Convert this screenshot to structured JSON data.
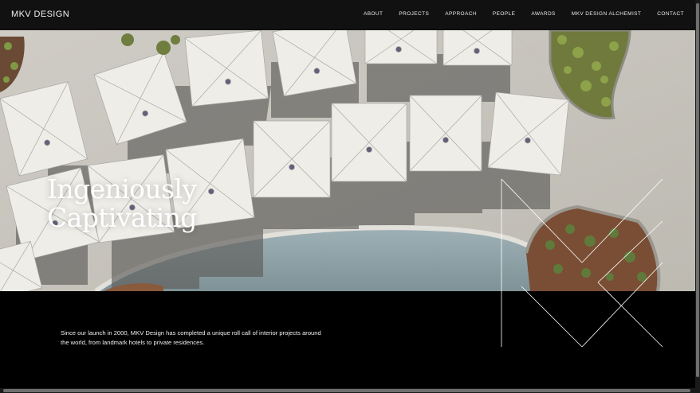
{
  "brand": {
    "name": "MKV DESIGN"
  },
  "nav": {
    "items": [
      "ABOUT",
      "PROJECTS",
      "APPROACH",
      "PEOPLE",
      "AWARDS",
      "MKV DESIGN ALCHEMIST",
      "CONTACT"
    ]
  },
  "hero": {
    "line1": "Ingeniously",
    "line2": "Captivating"
  },
  "intro": {
    "text": "Since our launch in 2000, MKV Design has completed a unique roll call of interior projects around the world, from landmark hotels to private residences."
  },
  "colors": {
    "topbar": "#111111",
    "background": "#000000",
    "text": "#ffffff"
  }
}
